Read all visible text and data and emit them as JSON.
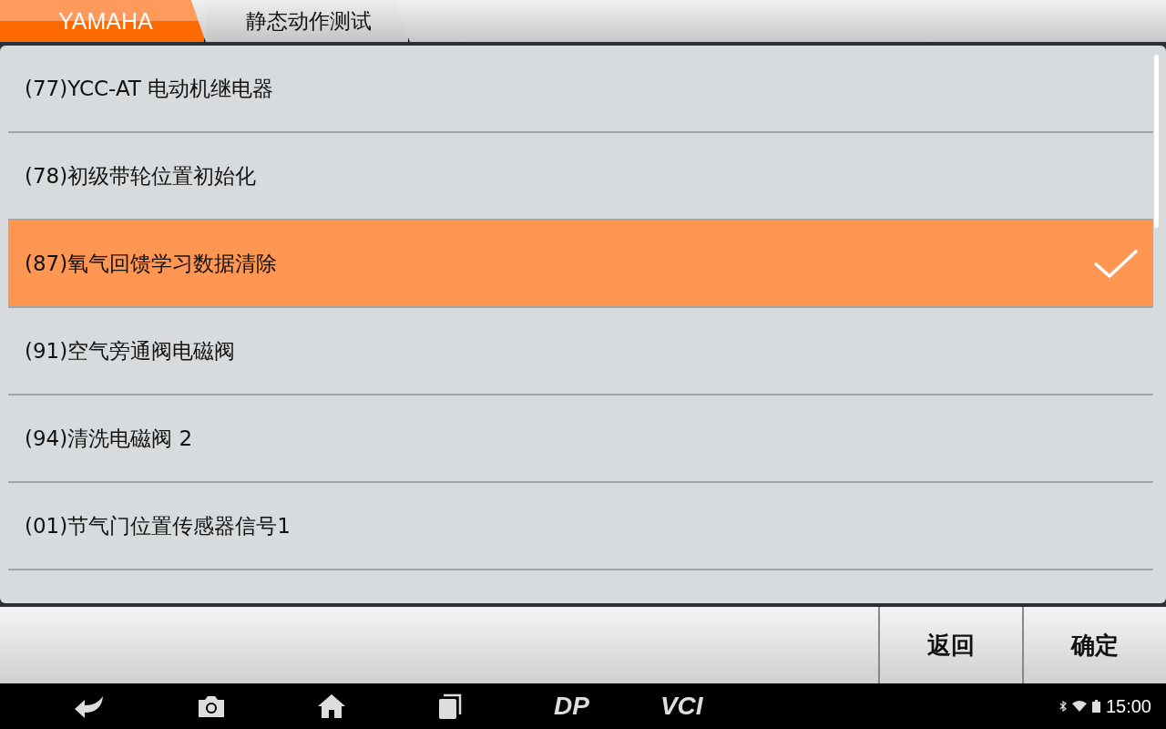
{
  "breadcrumb": [
    {
      "label": "YAMAHA",
      "selected": true
    },
    {
      "label": "静态动作测试",
      "selected": false
    }
  ],
  "list": [
    {
      "label": "(77)YCC-AT 电动机继电器",
      "selected": false
    },
    {
      "label": "(78)初级带轮位置初始化",
      "selected": false
    },
    {
      "label": "(87)氧气回馈学习数据清除",
      "selected": true
    },
    {
      "label": "(91)空气旁通阀电磁阀",
      "selected": false
    },
    {
      "label": "(94)清洗电磁阀 2",
      "selected": false
    },
    {
      "label": "(01)节气门位置传感器信号1",
      "selected": false
    }
  ],
  "buttons": [
    "返回",
    "确定"
  ],
  "nav": [
    {
      "kind": "back"
    },
    {
      "kind": "camera"
    },
    {
      "kind": "home"
    },
    {
      "kind": "recents"
    },
    {
      "kind": "text",
      "label": "DP"
    },
    {
      "kind": "text",
      "label": "VCI"
    }
  ],
  "status": {
    "time": "15:00"
  }
}
